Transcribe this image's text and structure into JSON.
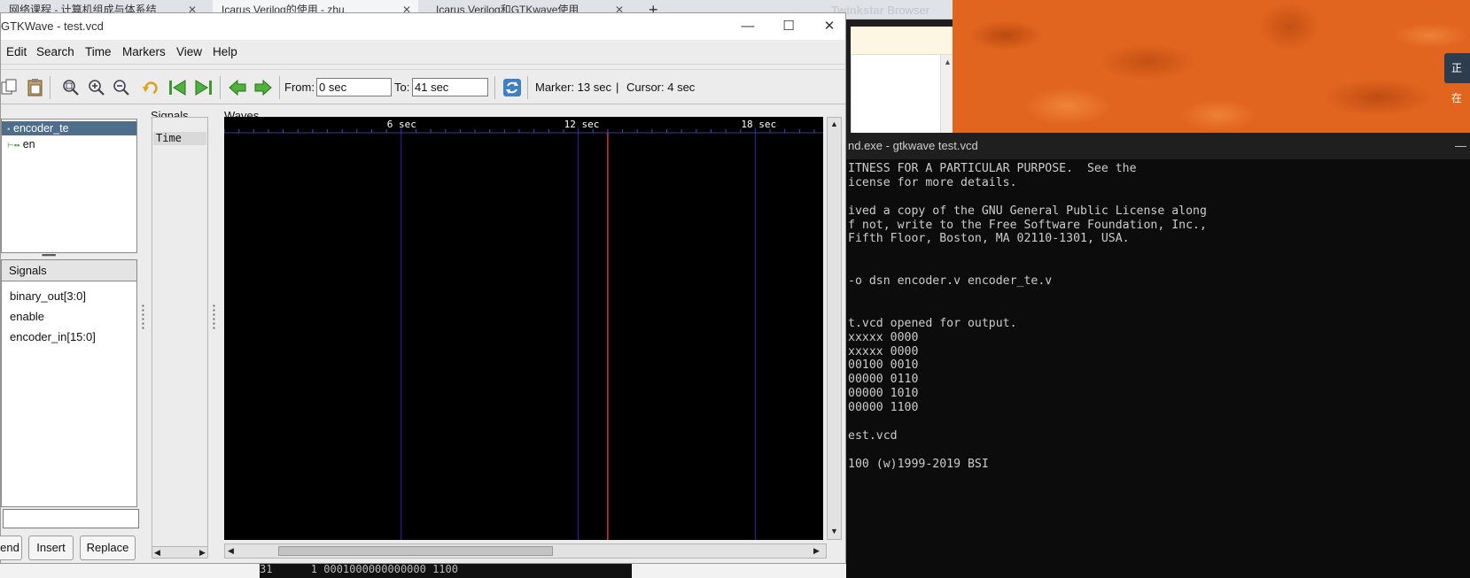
{
  "browser": {
    "tabs": [
      {
        "label": "网络课程 - 计算机组成与体系结"
      },
      {
        "label": "Icarus Verilog的使用 - zhu"
      },
      {
        "label": "Icarus Verilog和GTKwave使用"
      }
    ],
    "new_tab": "+",
    "brand_bold": "Twinkstar",
    "brand_rest": " Browser",
    "side_badge": "正在"
  },
  "gtkwave": {
    "title": "GTKWave - test.vcd",
    "menu": [
      "Edit",
      "Search",
      "Time",
      "Markers",
      "View",
      "Help"
    ],
    "toolbar": {
      "from_label": "From:",
      "from_value": "0 sec",
      "to_label": "To:",
      "to_value": "41 sec",
      "marker_text": "Marker: 13 sec",
      "separator": "|",
      "cursor_text": "Cursor: 4 sec"
    },
    "sst": {
      "tree": [
        {
          "label": "encoder_te",
          "selected": true
        },
        {
          "label": "en",
          "selected": false
        }
      ],
      "signals_header": "Signals",
      "signals": [
        "binary_out[3:0]",
        "enable",
        "encoder_in[15:0]"
      ],
      "search_value": "",
      "buttons": [
        "end",
        "Insert",
        "Replace"
      ]
    },
    "signals_pane": {
      "label": "Signals",
      "time_row": "Time"
    },
    "waves_pane": {
      "label": "Waves",
      "time_ticks": [
        {
          "label": "6 sec",
          "t": 6
        },
        {
          "label": "12 sec",
          "t": 12
        },
        {
          "label": "18 sec",
          "t": 18
        }
      ],
      "visible_range_sec": [
        0,
        20.3
      ],
      "marker_sec": 13,
      "marker_color": "#ff4040",
      "grid_color": "#2a2a9a"
    }
  },
  "console": {
    "title": "nd.exe - gtkwave  test.vcd",
    "lines": [
      "ITNESS FOR A PARTICULAR PURPOSE.  See the",
      "icense for more details.",
      "",
      "ived a copy of the GNU General Public License along",
      "f not, write to the Free Software Foundation, Inc.,",
      "Fifth Floor, Boston, MA 02110-1301, USA.",
      "",
      "",
      "-o dsn encoder.v encoder_te.v",
      "",
      "",
      "t.vcd opened for output.",
      "xxxxx 0000",
      "xxxxx 0000",
      "00100 0010",
      "00000 0110",
      "00000 1010",
      "00000 1100",
      "",
      "est.vcd",
      "",
      "100 (w)1999-2019 BSI"
    ]
  },
  "background_strip": {
    "text": "31      1 0001000000000000 1100"
  }
}
